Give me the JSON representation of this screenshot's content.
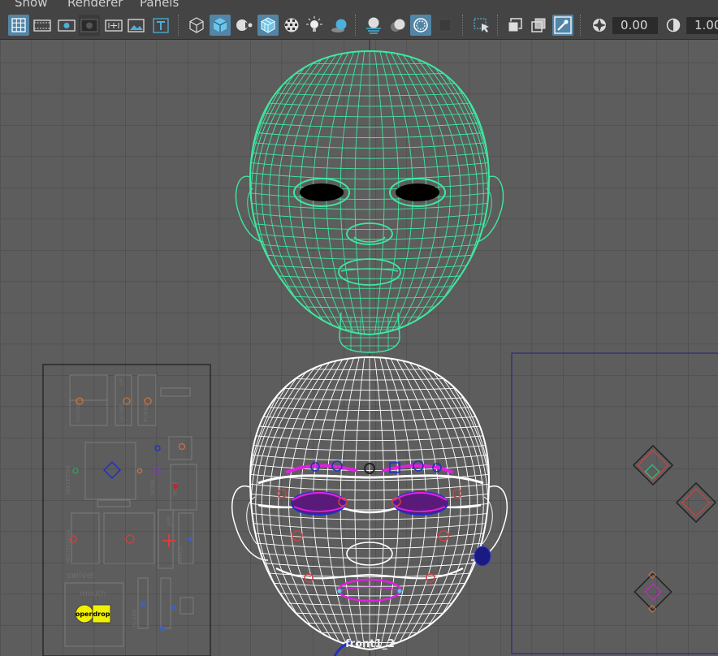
{
  "menu": {
    "items": [
      "Show",
      "Renderer",
      "Panels"
    ]
  },
  "toolbar": {
    "icons": [
      "grid-icon",
      "film-gate-icon",
      "resolution-gate-icon",
      "gate-mask-icon",
      "field-chart-icon",
      "image-plane-icon",
      "text-icon",
      "wireframe-icon",
      "smooth-shade-icon",
      "shaded-wireframe-icon",
      "wireframe-on-shaded-icon",
      "textured-icon",
      "use-all-lights-icon",
      "shadows-icon",
      "ambient-occlusion-icon",
      "motion-blur-icon",
      "anti-aliasing-icon",
      "depth-of-field-icon",
      "isolate-select-icon",
      "xray-icon",
      "xray-active-components-icon",
      "xray-joints-icon",
      "exposure-icon",
      "gamma-icon"
    ],
    "exposure_value": "0.00",
    "gamma_value": "1.00"
  },
  "viewport": {
    "camera_label": "front1_2",
    "colors": {
      "grid": "#4a4a4a",
      "background": "#5d5d5d",
      "face_top": "#3ee8a0",
      "face_bottom": "#ffffff",
      "control_magenta": "#e020e0",
      "control_blue": "#2030c0",
      "control_red": "#d04040"
    },
    "picker": {
      "labels": [
        "swivel",
        "mouth",
        "open",
        "drop",
        "squash",
        "UP",
        "DOWN",
        "PURSE",
        "SKELETON",
        "MOUTH/JAW",
        "JAW",
        "FLARE",
        "NOSE",
        "PUFF",
        "SMILE"
      ]
    }
  }
}
